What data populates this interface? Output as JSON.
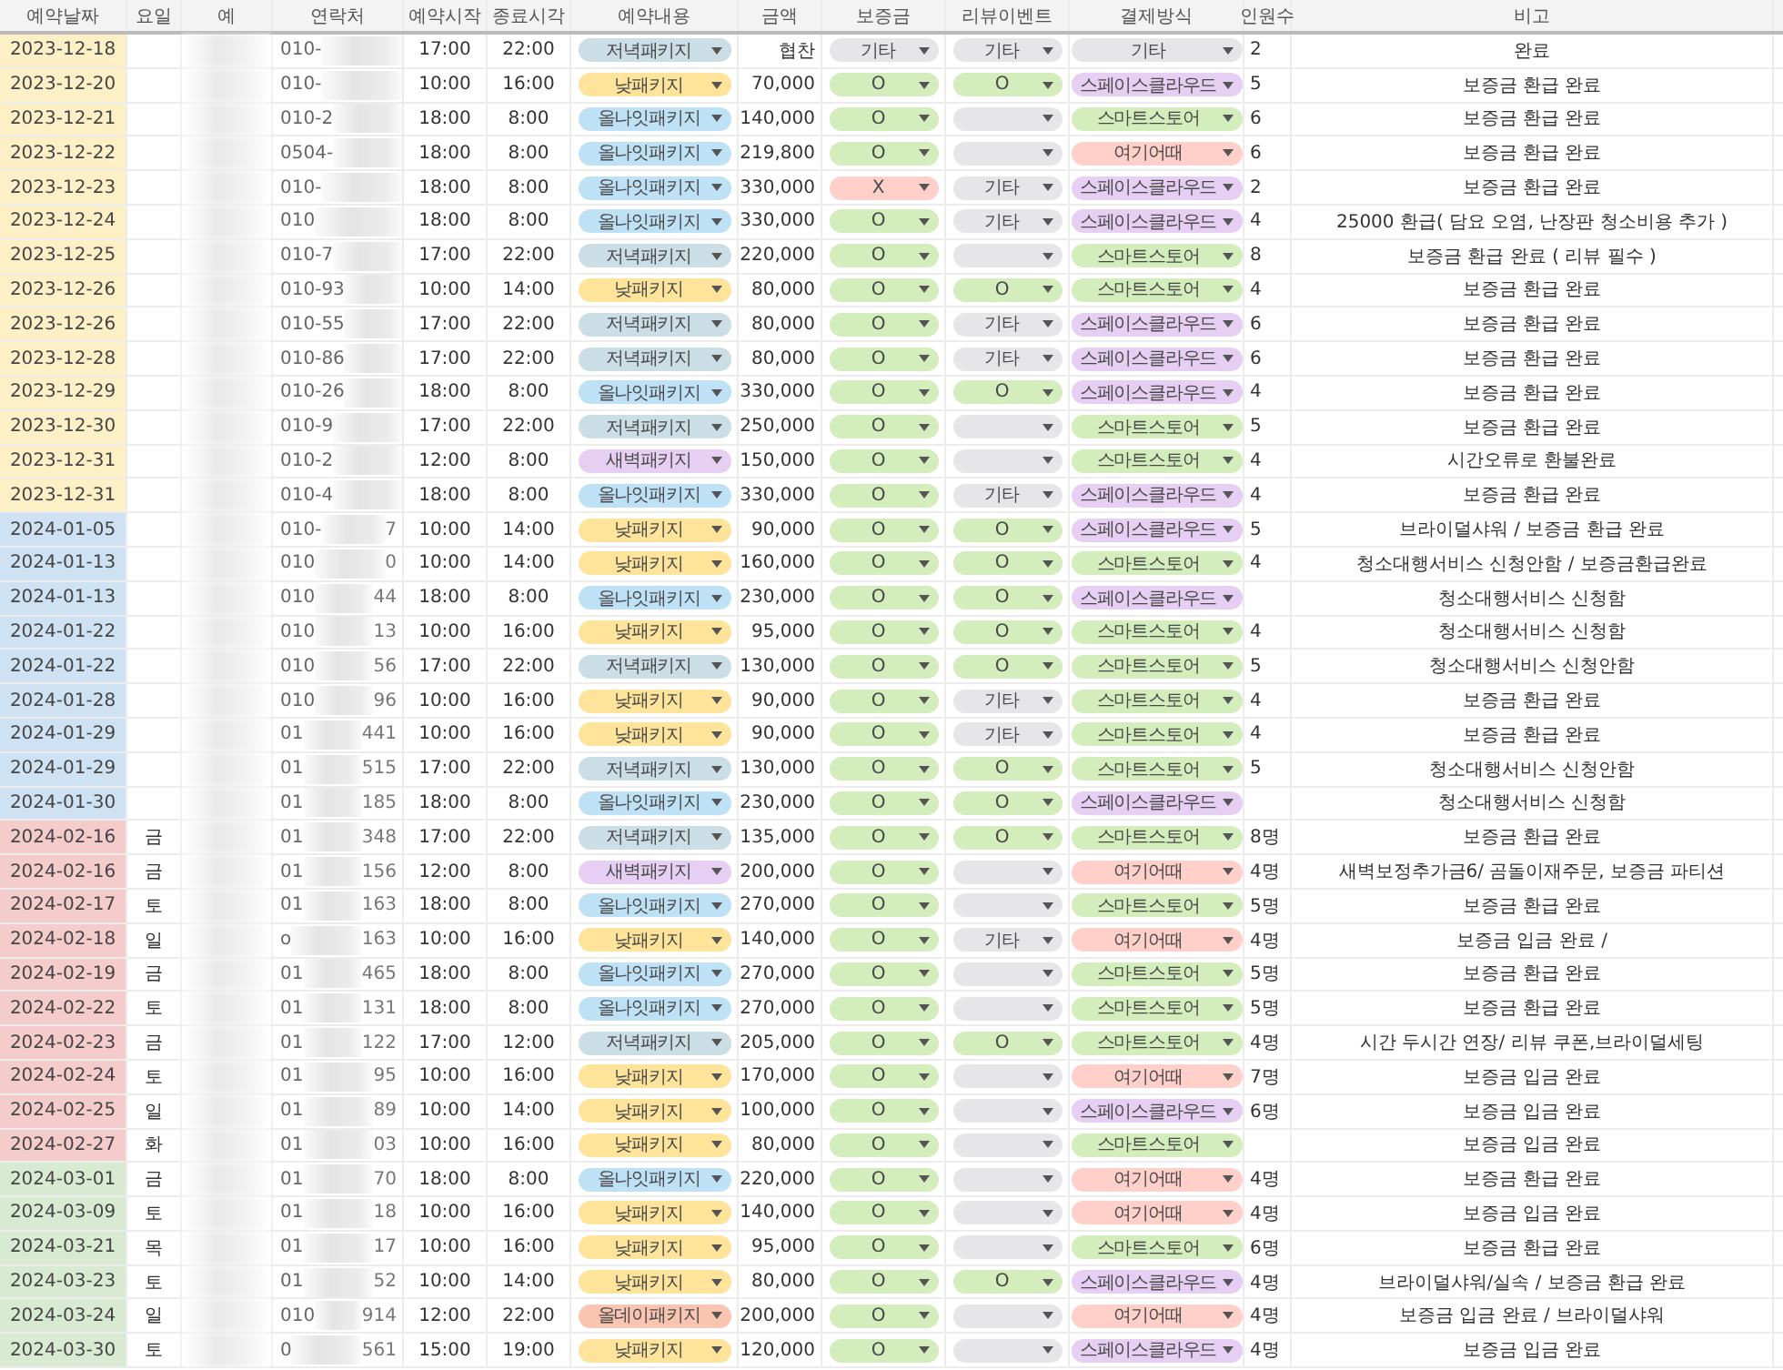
{
  "columns": [
    "예약날짜",
    "요일",
    "예",
    "연락처",
    "예약시작",
    "종료시각",
    "예약내용",
    "금액",
    "보증금",
    "리뷰이벤트",
    "결제방식",
    "인원수",
    "비고"
  ],
  "rows": [
    {
      "date": "2023-12-18",
      "color": "#fdefc6",
      "phone": [
        "010-"
      ],
      "start": "17:00",
      "end": "22:00",
      "package": {
        "text": "저녁패키지",
        "color": "#cbdde5"
      },
      "amount": "협찬",
      "deposit": {
        "text": "기타",
        "color": "#e6e6e8"
      },
      "review": {
        "text": "기타",
        "color": "#e6e6e8"
      },
      "payment": {
        "text": "기타",
        "color": "#e6e6e8"
      },
      "people": "2",
      "note": "완료"
    },
    {
      "date": "2023-12-20",
      "color": "#fdefc6",
      "phone": [
        "010-"
      ],
      "start": "10:00",
      "end": "16:00",
      "package": {
        "text": "낮패키지",
        "color": "#fde49a"
      },
      "amount": "70,000",
      "deposit": {
        "text": "O",
        "color": "#d4edbc"
      },
      "review": {
        "text": "O",
        "color": "#d4edbc"
      },
      "payment": {
        "text": "스페이스클라우드",
        "color": "#e6cff2"
      },
      "people": "5",
      "note": "보증금 환급 완료"
    },
    {
      "date": "2023-12-21",
      "color": "#fdefc6",
      "phone": [
        "010-2"
      ],
      "start": "18:00",
      "end": "8:00",
      "package": {
        "text": "올나잇패키지",
        "color": "#bfe1f6"
      },
      "amount": "140,000",
      "deposit": {
        "text": "O",
        "color": "#d4edbc"
      },
      "review": {
        "color": "#e6e6e8"
      },
      "payment": {
        "text": "스마트스토어",
        "color": "#d4edbc"
      },
      "people": "6",
      "note": "보증금 환급 완료"
    },
    {
      "date": "2023-12-22",
      "color": "#fdefc6",
      "phone": [
        "0504-"
      ],
      "start": "18:00",
      "end": "8:00",
      "package": {
        "text": "올나잇패키지",
        "color": "#bfe1f6"
      },
      "amount": "219,800",
      "deposit": {
        "text": "O",
        "color": "#d4edbc"
      },
      "review": {
        "color": "#e6e6e8"
      },
      "payment": {
        "text": "여기어때",
        "color": "#ffcfc9"
      },
      "people": "6",
      "note": "보증금 환급 완료"
    },
    {
      "date": "2023-12-23",
      "color": "#fdefc6",
      "phone": [
        "010-"
      ],
      "start": "18:00",
      "end": "8:00",
      "package": {
        "text": "올나잇패키지",
        "color": "#bfe1f6"
      },
      "amount": "330,000",
      "deposit": {
        "text": "X",
        "color": "#ffcfc9"
      },
      "review": {
        "text": "기타",
        "color": "#e6e6e8"
      },
      "payment": {
        "text": "스페이스클라우드",
        "color": "#e6cff2"
      },
      "people": "2",
      "note": "보증금 환급 완료"
    },
    {
      "date": "2023-12-24",
      "color": "#fdefc6",
      "phone": [
        "010"
      ],
      "start": "18:00",
      "end": "8:00",
      "package": {
        "text": "올나잇패키지",
        "color": "#bfe1f6"
      },
      "amount": "330,000",
      "deposit": {
        "text": "O",
        "color": "#d4edbc"
      },
      "review": {
        "text": "기타",
        "color": "#e6e6e8"
      },
      "payment": {
        "text": "스페이스클라우드",
        "color": "#e6cff2"
      },
      "people": "4",
      "note": "25000 환급( 담요 오염, 난장판 청소비용 추가 )"
    },
    {
      "date": "2023-12-25",
      "color": "#fdefc6",
      "phone": [
        "010-7"
      ],
      "start": "17:00",
      "end": "22:00",
      "package": {
        "text": "저녁패키지",
        "color": "#cbdde5"
      },
      "amount": "220,000",
      "deposit": {
        "text": "O",
        "color": "#d4edbc"
      },
      "review": {
        "color": "#e6e6e8"
      },
      "payment": {
        "text": "스마트스토어",
        "color": "#d4edbc"
      },
      "people": "8",
      "note": "보증금 환급 완료 ( 리뷰 필수 )"
    },
    {
      "date": "2023-12-26",
      "color": "#fdefc6",
      "phone": [
        "010-93"
      ],
      "start": "10:00",
      "end": "14:00",
      "package": {
        "text": "낮패키지",
        "color": "#fde49a"
      },
      "amount": "80,000",
      "deposit": {
        "text": "O",
        "color": "#d4edbc"
      },
      "review": {
        "text": "O",
        "color": "#d4edbc"
      },
      "payment": {
        "text": "스마트스토어",
        "color": "#d4edbc"
      },
      "people": "4",
      "note": "보증금 환급 완료"
    },
    {
      "date": "2023-12-26",
      "color": "#fdefc6",
      "phone": [
        "010-55"
      ],
      "start": "17:00",
      "end": "22:00",
      "package": {
        "text": "저녁패키지",
        "color": "#cbdde5"
      },
      "amount": "80,000",
      "deposit": {
        "text": "O",
        "color": "#d4edbc"
      },
      "review": {
        "text": "기타",
        "color": "#e6e6e8"
      },
      "payment": {
        "text": "스페이스클라우드",
        "color": "#e6cff2"
      },
      "people": "6",
      "note": "보증금 환급 완료"
    },
    {
      "date": "2023-12-28",
      "color": "#fdefc6",
      "phone": [
        "010-86"
      ],
      "start": "17:00",
      "end": "22:00",
      "package": {
        "text": "저녁패키지",
        "color": "#cbdde5"
      },
      "amount": "80,000",
      "deposit": {
        "text": "O",
        "color": "#d4edbc"
      },
      "review": {
        "text": "기타",
        "color": "#e6e6e8"
      },
      "payment": {
        "text": "스페이스클라우드",
        "color": "#e6cff2"
      },
      "people": "6",
      "note": "보증금 환급 완료"
    },
    {
      "date": "2023-12-29",
      "color": "#fdefc6",
      "phone": [
        "010-26"
      ],
      "start": "18:00",
      "end": "8:00",
      "package": {
        "text": "올나잇패키지",
        "color": "#bfe1f6"
      },
      "amount": "330,000",
      "deposit": {
        "text": "O",
        "color": "#d4edbc"
      },
      "review": {
        "text": "O",
        "color": "#d4edbc"
      },
      "payment": {
        "text": "스페이스클라우드",
        "color": "#e6cff2"
      },
      "people": "4",
      "note": "보증금 환급 완료"
    },
    {
      "date": "2023-12-30",
      "color": "#fdefc6",
      "phone": [
        "010-9"
      ],
      "start": "17:00",
      "end": "22:00",
      "package": {
        "text": "저녁패키지",
        "color": "#cbdde5"
      },
      "amount": "250,000",
      "deposit": {
        "text": "O",
        "color": "#d4edbc"
      },
      "review": {
        "color": "#e6e6e8"
      },
      "payment": {
        "text": "스마트스토어",
        "color": "#d4edbc"
      },
      "people": "5",
      "note": "보증금 환급 완료"
    },
    {
      "date": "2023-12-31",
      "color": "#fdefc6",
      "phone": [
        "010-2"
      ],
      "start": "12:00",
      "end": "8:00",
      "package": {
        "text": "새벽패키지",
        "color": "#e6cff2"
      },
      "amount": "150,000",
      "deposit": {
        "text": "O",
        "color": "#d4edbc"
      },
      "review": {
        "color": "#e6e6e8"
      },
      "payment": {
        "text": "스마트스토어",
        "color": "#d4edbc"
      },
      "people": "4",
      "note": "시간오류로 환불완료"
    },
    {
      "date": "2023-12-31",
      "color": "#fdefc6",
      "phone": [
        "010-4"
      ],
      "start": "18:00",
      "end": "8:00",
      "package": {
        "text": "올나잇패키지",
        "color": "#bfe1f6"
      },
      "amount": "330,000",
      "deposit": {
        "text": "O",
        "color": "#d4edbc"
      },
      "review": {
        "text": "기타",
        "color": "#e6e6e8"
      },
      "payment": {
        "text": "스페이스클라우드",
        "color": "#e6cff2"
      },
      "people": "4",
      "note": "보증금 환급 완료"
    },
    {
      "date": "2024-01-05",
      "color": "#cfe2f3",
      "phone": [
        "010-",
        "7"
      ],
      "start": "10:00",
      "end": "14:00",
      "package": {
        "text": "낮패키지",
        "color": "#fde49a"
      },
      "amount": "90,000",
      "deposit": {
        "text": "O",
        "color": "#d4edbc"
      },
      "review": {
        "text": "O",
        "color": "#d4edbc"
      },
      "payment": {
        "text": "스페이스클라우드",
        "color": "#e6cff2"
      },
      "people": "5",
      "note": "브라이덜샤워 / 보증금 환급 완료"
    },
    {
      "date": "2024-01-13",
      "color": "#cfe2f3",
      "phone": [
        "010",
        "0"
      ],
      "start": "10:00",
      "end": "14:00",
      "package": {
        "text": "낮패키지",
        "color": "#fde49a"
      },
      "amount": "160,000",
      "deposit": {
        "text": "O",
        "color": "#d4edbc"
      },
      "review": {
        "text": "O",
        "color": "#d4edbc"
      },
      "payment": {
        "text": "스마트스토어",
        "color": "#d4edbc"
      },
      "people": "4",
      "note": "청소대행서비스 신청안함 / 보증금환급완료"
    },
    {
      "date": "2024-01-13",
      "color": "#cfe2f3",
      "phone": [
        "010",
        "44"
      ],
      "start": "18:00",
      "end": "8:00",
      "package": {
        "text": "올나잇패키지",
        "color": "#bfe1f6"
      },
      "amount": "230,000",
      "deposit": {
        "text": "O",
        "color": "#d4edbc"
      },
      "review": {
        "text": "O",
        "color": "#d4edbc"
      },
      "payment": {
        "text": "스페이스클라우드",
        "color": "#e6cff2"
      },
      "note": "청소대행서비스 신청함"
    },
    {
      "date": "2024-01-22",
      "color": "#cfe2f3",
      "phone": [
        "010",
        "13"
      ],
      "start": "10:00",
      "end": "16:00",
      "package": {
        "text": "낮패키지",
        "color": "#fde49a"
      },
      "amount": "95,000",
      "deposit": {
        "text": "O",
        "color": "#d4edbc"
      },
      "review": {
        "text": "O",
        "color": "#d4edbc"
      },
      "payment": {
        "text": "스마트스토어",
        "color": "#d4edbc"
      },
      "people": "4",
      "note": "청소대행서비스 신청함"
    },
    {
      "date": "2024-01-22",
      "color": "#cfe2f3",
      "phone": [
        "010",
        "56"
      ],
      "start": "17:00",
      "end": "22:00",
      "package": {
        "text": "저녁패키지",
        "color": "#cbdde5"
      },
      "amount": "130,000",
      "deposit": {
        "text": "O",
        "color": "#d4edbc"
      },
      "review": {
        "text": "O",
        "color": "#d4edbc"
      },
      "payment": {
        "text": "스마트스토어",
        "color": "#d4edbc"
      },
      "people": "5",
      "note": "청소대행서비스 신청안함"
    },
    {
      "date": "2024-01-28",
      "color": "#cfe2f3",
      "phone": [
        "010",
        "96"
      ],
      "start": "10:00",
      "end": "16:00",
      "package": {
        "text": "낮패키지",
        "color": "#fde49a"
      },
      "amount": "90,000",
      "deposit": {
        "text": "O",
        "color": "#d4edbc"
      },
      "review": {
        "text": "기타",
        "color": "#e6e6e8"
      },
      "payment": {
        "text": "스마트스토어",
        "color": "#d4edbc"
      },
      "people": "4",
      "note": "보증금 환급 완료"
    },
    {
      "date": "2024-01-29",
      "color": "#cfe2f3",
      "phone": [
        "01",
        "441"
      ],
      "start": "10:00",
      "end": "16:00",
      "package": {
        "text": "낮패키지",
        "color": "#fde49a"
      },
      "amount": "90,000",
      "deposit": {
        "text": "O",
        "color": "#d4edbc"
      },
      "review": {
        "text": "기타",
        "color": "#e6e6e8"
      },
      "payment": {
        "text": "스마트스토어",
        "color": "#d4edbc"
      },
      "people": "4",
      "note": "보증금 환급 완료"
    },
    {
      "date": "2024-01-29",
      "color": "#cfe2f3",
      "phone": [
        "01",
        "515"
      ],
      "start": "17:00",
      "end": "22:00",
      "package": {
        "text": "저녁패키지",
        "color": "#cbdde5"
      },
      "amount": "130,000",
      "deposit": {
        "text": "O",
        "color": "#d4edbc"
      },
      "review": {
        "text": "O",
        "color": "#d4edbc"
      },
      "payment": {
        "text": "스마트스토어",
        "color": "#d4edbc"
      },
      "people": "5",
      "note": "청소대행서비스 신청안함"
    },
    {
      "date": "2024-01-30",
      "color": "#cfe2f3",
      "phone": [
        "01",
        "185"
      ],
      "start": "18:00",
      "end": "8:00",
      "package": {
        "text": "올나잇패키지",
        "color": "#bfe1f6"
      },
      "amount": "230,000",
      "deposit": {
        "text": "O",
        "color": "#d4edbc"
      },
      "review": {
        "text": "O",
        "color": "#d4edbc"
      },
      "payment": {
        "text": "스페이스클라우드",
        "color": "#e6cff2"
      },
      "note": "청소대행서비스 신청함"
    },
    {
      "date": "2024-02-16",
      "color": "#f4cccc",
      "day": "금",
      "phone": [
        "01",
        "348"
      ],
      "start": "17:00",
      "end": "22:00",
      "package": {
        "text": "저녁패키지",
        "color": "#cbdde5"
      },
      "amount": "135,000",
      "deposit": {
        "text": "O",
        "color": "#d4edbc"
      },
      "review": {
        "text": "O",
        "color": "#d4edbc"
      },
      "payment": {
        "text": "스마트스토어",
        "color": "#d4edbc"
      },
      "people": "8명",
      "note": "보증금 환급 완료"
    },
    {
      "date": "2024-02-16",
      "color": "#f4cccc",
      "day": "금",
      "phone": [
        "01",
        "156"
      ],
      "start": "12:00",
      "end": "8:00",
      "package": {
        "text": "새벽패키지",
        "color": "#e6cff2"
      },
      "amount": "200,000",
      "deposit": {
        "text": "O",
        "color": "#d4edbc"
      },
      "review": {
        "color": "#e6e6e8"
      },
      "payment": {
        "text": "여기어때",
        "color": "#ffcfc9"
      },
      "people": "4명",
      "note": "새벽보정추가금6/ 곰돌이재주문, 보증금 파티션"
    },
    {
      "date": "2024-02-17",
      "color": "#f4cccc",
      "day": "토",
      "phone": [
        "01",
        "163"
      ],
      "start": "18:00",
      "end": "8:00",
      "package": {
        "text": "올나잇패키지",
        "color": "#bfe1f6"
      },
      "amount": "270,000",
      "deposit": {
        "text": "O",
        "color": "#d4edbc"
      },
      "review": {
        "color": "#e6e6e8"
      },
      "payment": {
        "text": "스마트스토어",
        "color": "#d4edbc"
      },
      "people": "5명",
      "note": "보증금 환급 완료"
    },
    {
      "date": "2024-02-18",
      "color": "#f4cccc",
      "day": "일",
      "phone": [
        "o",
        "163"
      ],
      "start": "10:00",
      "end": "16:00",
      "package": {
        "text": "낮패키지",
        "color": "#fde49a"
      },
      "amount": "140,000",
      "deposit": {
        "text": "O",
        "color": "#d4edbc"
      },
      "review": {
        "text": "기타",
        "color": "#e6e6e8"
      },
      "payment": {
        "text": "여기어때",
        "color": "#ffcfc9"
      },
      "people": "4명",
      "note": "보증금 입금 완료 /"
    },
    {
      "date": "2024-02-19",
      "color": "#f4cccc",
      "day": "금",
      "phone": [
        "01",
        "465"
      ],
      "start": "18:00",
      "end": "8:00",
      "package": {
        "text": "올나잇패키지",
        "color": "#bfe1f6"
      },
      "amount": "270,000",
      "deposit": {
        "text": "O",
        "color": "#d4edbc"
      },
      "review": {
        "color": "#e6e6e8"
      },
      "payment": {
        "text": "스마트스토어",
        "color": "#d4edbc"
      },
      "people": "5명",
      "note": "보증금 환급 완료"
    },
    {
      "date": "2024-02-22",
      "color": "#f4cccc",
      "day": "토",
      "phone": [
        "01",
        "131"
      ],
      "start": "18:00",
      "end": "8:00",
      "package": {
        "text": "올나잇패키지",
        "color": "#bfe1f6"
      },
      "amount": "270,000",
      "deposit": {
        "text": "O",
        "color": "#d4edbc"
      },
      "review": {
        "color": "#e6e6e8"
      },
      "payment": {
        "text": "스마트스토어",
        "color": "#d4edbc"
      },
      "people": "5명",
      "note": "보증금 환급 완료"
    },
    {
      "date": "2024-02-23",
      "color": "#f4cccc",
      "day": "금",
      "phone": [
        "01",
        "122"
      ],
      "start": "17:00",
      "end": "12:00",
      "package": {
        "text": "저녁패키지",
        "color": "#cbdde5"
      },
      "amount": "205,000",
      "deposit": {
        "text": "O",
        "color": "#d4edbc"
      },
      "review": {
        "text": "O",
        "color": "#d4edbc"
      },
      "payment": {
        "text": "스마트스토어",
        "color": "#d4edbc"
      },
      "people": "4명",
      "note": "시간 두시간 연장/ 리뷰 쿠폰,브라이덜세팅"
    },
    {
      "date": "2024-02-24",
      "color": "#f4cccc",
      "day": "토",
      "phone": [
        "01",
        "95"
      ],
      "start": "10:00",
      "end": "16:00",
      "package": {
        "text": "낮패키지",
        "color": "#fde49a"
      },
      "amount": "170,000",
      "deposit": {
        "text": "O",
        "color": "#d4edbc"
      },
      "review": {
        "color": "#e6e6e8"
      },
      "payment": {
        "text": "여기어때",
        "color": "#ffcfc9"
      },
      "people": "7명",
      "note": "보증금 입금 완료"
    },
    {
      "date": "2024-02-25",
      "color": "#f4cccc",
      "day": "일",
      "phone": [
        "01",
        "89"
      ],
      "start": "10:00",
      "end": "14:00",
      "package": {
        "text": "낮패키지",
        "color": "#fde49a"
      },
      "amount": "100,000",
      "deposit": {
        "text": "O",
        "color": "#d4edbc"
      },
      "review": {
        "color": "#e6e6e8"
      },
      "payment": {
        "text": "스페이스클라우드",
        "color": "#e6cff2"
      },
      "people": "6명",
      "note": "보증금 입금 완료"
    },
    {
      "date": "2024-02-27",
      "color": "#f4cccc",
      "day": "화",
      "phone": [
        "01",
        "03"
      ],
      "start": "10:00",
      "end": "16:00",
      "package": {
        "text": "낮패키지",
        "color": "#fde49a"
      },
      "amount": "80,000",
      "deposit": {
        "text": "O",
        "color": "#d4edbc"
      },
      "review": {
        "color": "#e6e6e8"
      },
      "payment": {
        "text": "스마트스토어",
        "color": "#d4edbc"
      },
      "note": "보증금 입금 완료"
    },
    {
      "date": "2024-03-01",
      "color": "#d9ead3",
      "day": "금",
      "phone": [
        "01",
        "70"
      ],
      "start": "18:00",
      "end": "8:00",
      "package": {
        "text": "올나잇패키지",
        "color": "#bfe1f6"
      },
      "amount": "220,000",
      "deposit": {
        "text": "O",
        "color": "#d4edbc"
      },
      "review": {
        "color": "#e6e6e8"
      },
      "payment": {
        "text": "여기어때",
        "color": "#ffcfc9"
      },
      "people": "4명",
      "note": "보증금 환급 완료"
    },
    {
      "date": "2024-03-09",
      "color": "#d9ead3",
      "day": "토",
      "phone": [
        "01",
        "18"
      ],
      "start": "10:00",
      "end": "16:00",
      "package": {
        "text": "낮패키지",
        "color": "#fde49a"
      },
      "amount": "140,000",
      "deposit": {
        "text": "O",
        "color": "#d4edbc"
      },
      "review": {
        "color": "#e6e6e8"
      },
      "payment": {
        "text": "여기어때",
        "color": "#ffcfc9"
      },
      "people": "4명",
      "note": "보증금 입금 완료"
    },
    {
      "date": "2024-03-21",
      "color": "#d9ead3",
      "day": "목",
      "phone": [
        "01",
        "17"
      ],
      "start": "10:00",
      "end": "16:00",
      "package": {
        "text": "낮패키지",
        "color": "#fde49a"
      },
      "amount": "95,000",
      "deposit": {
        "text": "O",
        "color": "#d4edbc"
      },
      "review": {
        "color": "#e6e6e8"
      },
      "payment": {
        "text": "스마트스토어",
        "color": "#d4edbc"
      },
      "people": "6명",
      "note": "보증금 환급 완료"
    },
    {
      "date": "2024-03-23",
      "color": "#d9ead3",
      "day": "토",
      "phone": [
        "01",
        "52"
      ],
      "start": "10:00",
      "end": "14:00",
      "package": {
        "text": "낮패키지",
        "color": "#fde49a"
      },
      "amount": "80,000",
      "deposit": {
        "text": "O",
        "color": "#d4edbc"
      },
      "review": {
        "text": "O",
        "color": "#d4edbc"
      },
      "payment": {
        "text": "스페이스클라우드",
        "color": "#e6cff2"
      },
      "people": "4명",
      "note": "브라이덜샤워/실속 / 보증금 환급 완료"
    },
    {
      "date": "2024-03-24",
      "color": "#d9ead3",
      "day": "일",
      "phone": [
        "010",
        "914"
      ],
      "start": "12:00",
      "end": "22:00",
      "package": {
        "text": "올데이패키지",
        "color": "#f9c4b0"
      },
      "amount": "200,000",
      "deposit": {
        "text": "O",
        "color": "#d4edbc"
      },
      "review": {
        "color": "#e6e6e8"
      },
      "payment": {
        "text": "여기어때",
        "color": "#ffcfc9"
      },
      "people": "4명",
      "note": "보증금 입금 완료 / 브라이덜샤워"
    },
    {
      "date": "2024-03-30",
      "color": "#d9ead3",
      "day": "토",
      "phone": [
        "0",
        "561"
      ],
      "start": "15:00",
      "end": "19:00",
      "package": {
        "text": "낮패키지",
        "color": "#fde49a"
      },
      "amount": "120,000",
      "deposit": {
        "text": "O",
        "color": "#d4edbc"
      },
      "review": {
        "color": "#e6e6e8"
      },
      "payment": {
        "text": "스페이스클라우드",
        "color": "#e6cff2"
      },
      "people": "4명",
      "note": "보증금 입금 완료"
    }
  ]
}
